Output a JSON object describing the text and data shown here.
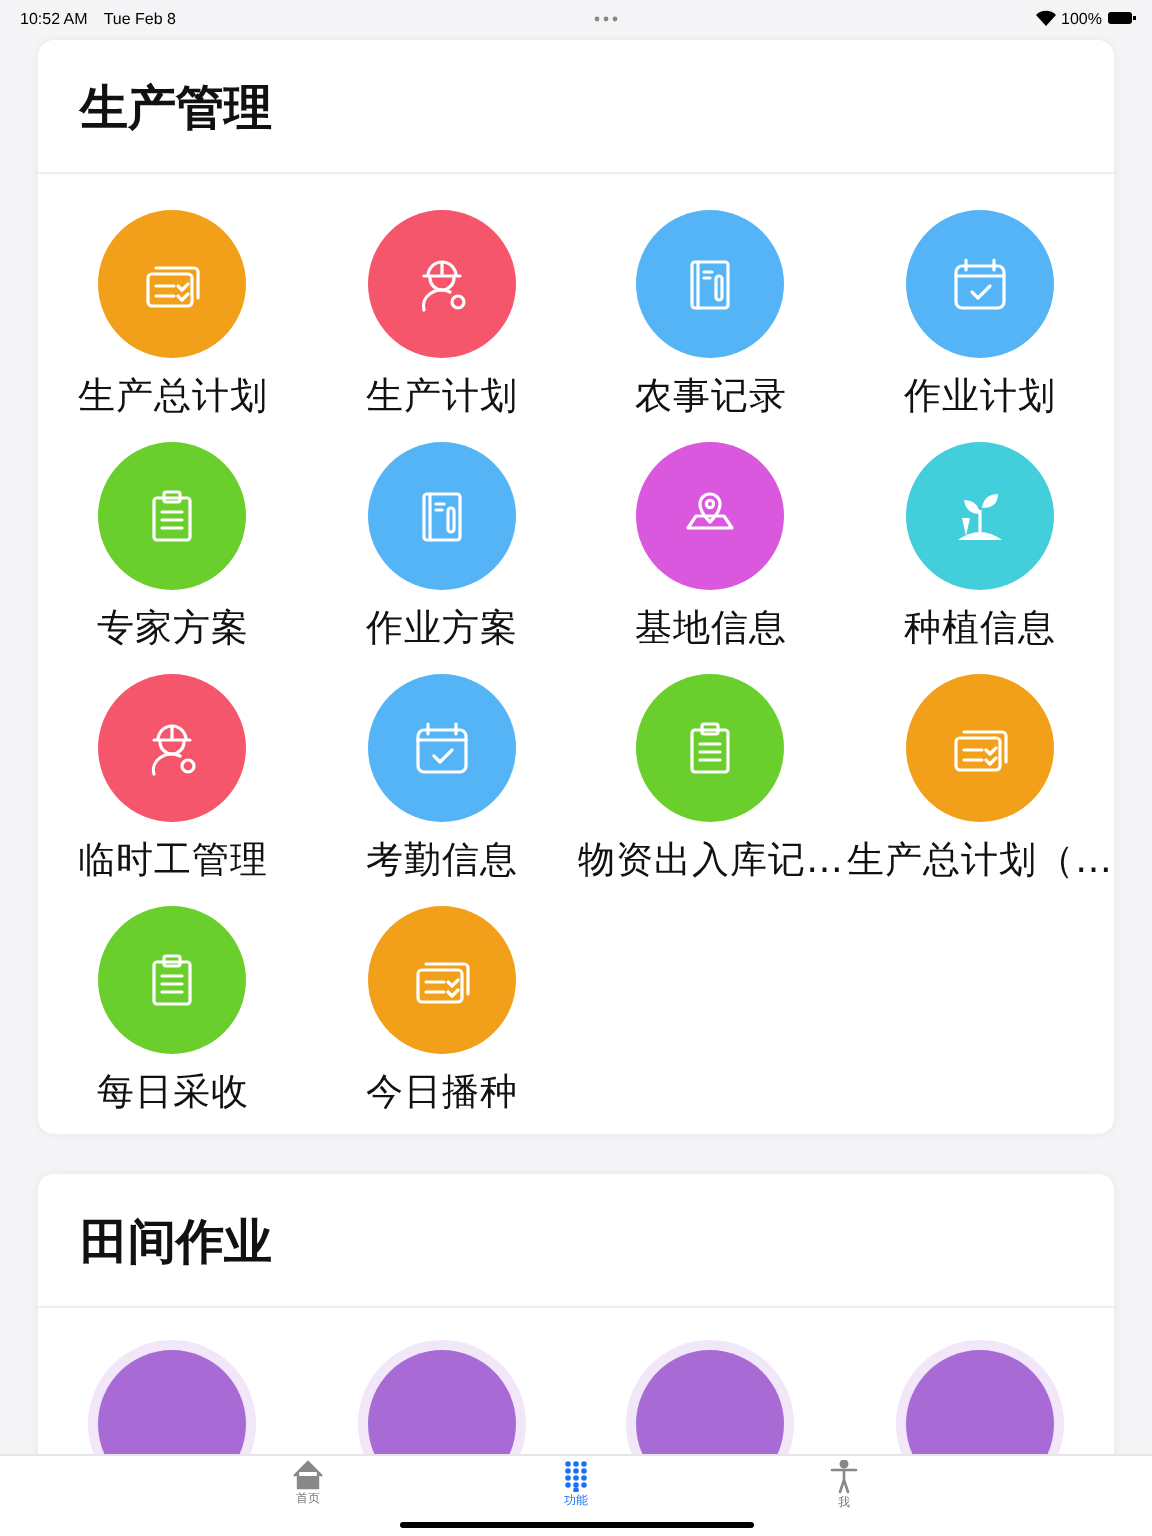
{
  "status_bar": {
    "time": "10:52 AM",
    "date": "Tue Feb 8",
    "battery": "100%"
  },
  "sections": [
    {
      "title": "生产管理",
      "items": [
        {
          "label": "生产总计划",
          "kind": "cards",
          "color": "#f2a019"
        },
        {
          "label": "生产计划",
          "kind": "worker",
          "color": "#f5566b"
        },
        {
          "label": "农事记录",
          "kind": "notebook",
          "color": "#54b4f6"
        },
        {
          "label": "作业计划",
          "kind": "calendar",
          "color": "#54b4f6"
        },
        {
          "label": "专家方案",
          "kind": "clipboard",
          "color": "#6acf2c"
        },
        {
          "label": "作业方案",
          "kind": "notebook",
          "color": "#54b4f6"
        },
        {
          "label": "基地信息",
          "kind": "map",
          "color": "#d958de"
        },
        {
          "label": "种植信息",
          "kind": "plant",
          "color": "#43cedc"
        },
        {
          "label": "临时工管理",
          "kind": "worker",
          "color": "#f5566b"
        },
        {
          "label": "考勤信息",
          "kind": "calendar",
          "color": "#54b4f6"
        },
        {
          "label": "物资出入库记…",
          "kind": "clipboard",
          "color": "#6acf2c"
        },
        {
          "label": "生产总计划（…",
          "kind": "cards",
          "color": "#f2a019"
        },
        {
          "label": "每日采收",
          "kind": "clipboard",
          "color": "#6acf2c"
        },
        {
          "label": "今日播种",
          "kind": "cards",
          "color": "#f2a019"
        }
      ]
    },
    {
      "title": "田间作业",
      "items": [
        {
          "color": "#a86bd6"
        },
        {
          "color": "#a86bd6"
        },
        {
          "color": "#a86bd6"
        },
        {
          "color": "#a86bd6"
        }
      ]
    }
  ],
  "tab_bar": [
    {
      "label": "首页",
      "kind": "home",
      "selected": false
    },
    {
      "label": "功能",
      "kind": "dots",
      "selected": true
    },
    {
      "label": "我",
      "kind": "person",
      "selected": false
    }
  ]
}
